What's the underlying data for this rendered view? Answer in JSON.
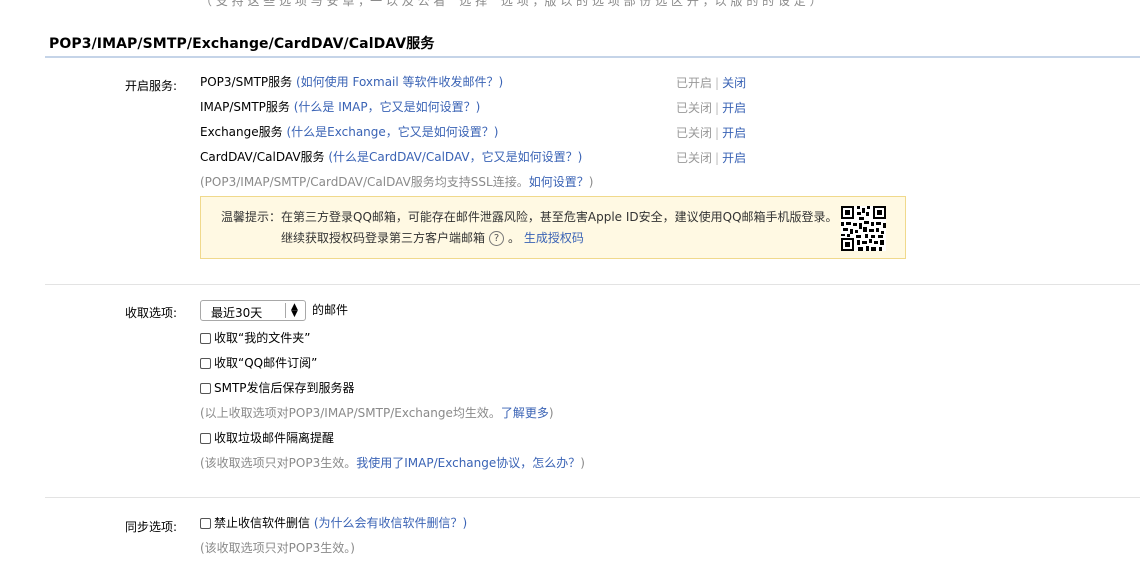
{
  "top_cut_text": "（ 支 持 这 些 选 项 与 安 卓 ，一 以 及 公 看 “ 选 择 ” 选 项 ，版 以 的 选 项 部 份 选 区 开 ，以 版 的 的 设 定 ）",
  "section_title": "POP3/IMAP/SMTP/Exchange/CardDAV/CalDAV服务",
  "services": {
    "label": "开启服务:",
    "items": [
      {
        "name": "POP3/SMTP服务",
        "hint": "(如何使用 Foxmail 等软件收发邮件？)",
        "status": "已开启",
        "action": "关闭"
      },
      {
        "name": "IMAP/SMTP服务",
        "hint": "(什么是 IMAP，它又是如何设置？)",
        "status": "已关闭",
        "action": "开启"
      },
      {
        "name": "Exchange服务",
        "hint": "(什么是Exchange，它又是如何设置？)",
        "status": "已关闭",
        "action": "开启"
      },
      {
        "name": "CardDAV/CalDAV服务",
        "hint": "(什么是CardDAV/CalDAV，它又是如何设置？)",
        "status": "已关闭",
        "action": "开启"
      }
    ],
    "ssl_note_pre": "(POP3/IMAP/SMTP/CardDAV/CalDAV服务均支持SSL连接。",
    "ssl_note_link": "如何设置？",
    "ssl_note_post": ")",
    "separator": "|"
  },
  "warning": {
    "line1": "温馨提示：在第三方登录QQ邮箱，可能存在邮件泄露风险，甚至危害Apple ID安全，建议使用QQ邮箱手机版登录。",
    "line2_pre": "继续获取授权码登录第三方客户端邮箱",
    "question_mark": "?",
    "line2_mid": "。",
    "generate_link": "生成授权码"
  },
  "receive": {
    "label": "收取选项:",
    "range_value": "最近30天",
    "range_suffix": "的邮件",
    "checkboxes": [
      "收取“我的文件夹”",
      "收取“QQ邮件订阅”",
      "SMTP发信后保存到服务器"
    ],
    "note1_pre": "(以上收取选项对POP3/IMAP/SMTP/Exchange均生效。",
    "note1_link": "了解更多",
    "note1_post": ")",
    "spam_checkbox": "收取垃圾邮件隔离提醒",
    "note2_pre": "(该收取选项只对POP3生效。",
    "note2_link": "我使用了IMAP/Exchange协议，怎么办？",
    "note2_post": ")"
  },
  "sync": {
    "label": "同步选项:",
    "checkbox": "禁止收信软件删信",
    "hint": "(为什么会有收信软件删信？)",
    "note": "(该收取选项只对POP3生效。)"
  },
  "colors": {
    "link": "#3a63b5",
    "muted": "#8a8a8a",
    "warning_bg": "#fff9e3",
    "warning_border": "#f0d98c"
  },
  "icons": {
    "qr": "qr-code-icon",
    "help": "question-circle-icon",
    "select_arrow": "updown-arrow-icon"
  }
}
